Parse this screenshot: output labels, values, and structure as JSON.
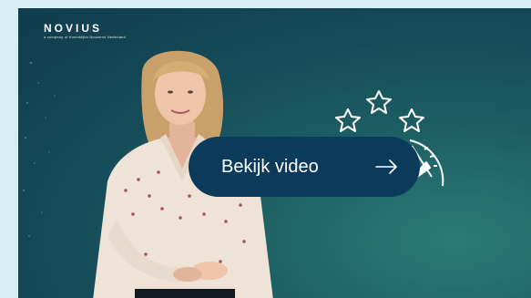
{
  "logo": {
    "wordmark": "NOVIUS",
    "tagline": "a company of Koninklijke Bouwend Nederland"
  },
  "video": {
    "cta_label": "Bekijk video",
    "cta_icon": "arrow-right-icon",
    "graphic_icon": "rating-gauge-with-stars-icon"
  },
  "colors": {
    "page_background": "#d6edf1",
    "video_background": "#154a58",
    "button_background": "#0c3a5a",
    "foreground": "#ffffff"
  }
}
